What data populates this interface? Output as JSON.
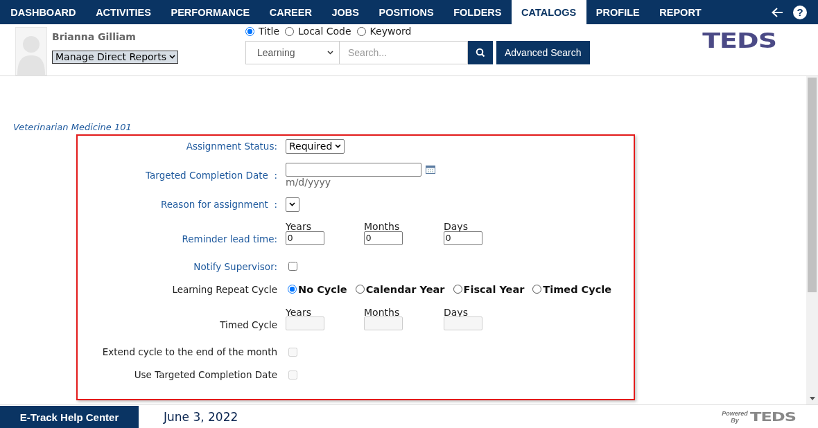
{
  "nav": {
    "items": [
      {
        "label": "DASHBOARD",
        "selected": false
      },
      {
        "label": "ACTIVITIES",
        "selected": false
      },
      {
        "label": "PERFORMANCE",
        "selected": false
      },
      {
        "label": "CAREER",
        "selected": false
      },
      {
        "label": "JOBS",
        "selected": false
      },
      {
        "label": "POSITIONS",
        "selected": false
      },
      {
        "label": "FOLDERS",
        "selected": false
      },
      {
        "label": "CATALOGS",
        "selected": true
      },
      {
        "label": "PROFILE",
        "selected": false
      },
      {
        "label": "REPORT",
        "selected": false
      }
    ],
    "help": "?"
  },
  "header": {
    "user_name": "Brianna Gilliam",
    "manage_select": "Manage Direct Reports",
    "search_by": [
      {
        "label": "Title",
        "selected": true
      },
      {
        "label": "Local Code",
        "selected": false
      },
      {
        "label": "Keyword",
        "selected": false
      }
    ],
    "category": "Learning",
    "search": {
      "placeholder": "Search..."
    },
    "advanced_search": "Advanced Search",
    "logo": "TEDS"
  },
  "content": {
    "course_title": "Veterinarian Medicine 101",
    "rows": [
      {
        "kind": "select",
        "label": "Assignment Status:",
        "color": "#1f5a9e",
        "value": "Required"
      },
      {
        "kind": "date",
        "label": "Targeted Completion Date  :",
        "color": "#1f5a9e",
        "hint": "m/d/yyyy"
      },
      {
        "kind": "select",
        "label": "Reason for assignment  :",
        "color": "#1f5a9e"
      },
      {
        "kind": "triple",
        "label": "Reminder lead time:",
        "color": "#1f5a9e",
        "fields": [
          {
            "label": "Years",
            "value": "0",
            "disabled": false
          },
          {
            "label": "Months",
            "value": "0",
            "disabled": false
          },
          {
            "label": "Days",
            "value": "0",
            "disabled": false
          }
        ]
      },
      {
        "kind": "checkbox",
        "label": "Notify Supervisor:",
        "color": "#1f5a9e",
        "checked": false,
        "disabled": false
      },
      {
        "kind": "radio",
        "label": "Learning Repeat Cycle",
        "color": "#222222",
        "options": [
          {
            "label": "No Cycle",
            "selected": true
          },
          {
            "label": "Calendar Year",
            "selected": false
          },
          {
            "label": "Fiscal Year",
            "selected": false
          },
          {
            "label": "Timed Cycle",
            "selected": false
          }
        ]
      },
      {
        "kind": "triple",
        "label": "Timed Cycle",
        "color": "#222222",
        "fields": [
          {
            "label": "Years",
            "disabled": true
          },
          {
            "label": "Months",
            "disabled": true
          },
          {
            "label": "Days",
            "disabled": true
          }
        ]
      },
      {
        "kind": "checkbox",
        "label": "Extend cycle to the end of the month",
        "color": "#222222",
        "checked": false,
        "disabled": true
      },
      {
        "kind": "checkbox",
        "label": "Use Targeted Completion Date",
        "color": "#222222",
        "checked": false,
        "disabled": true
      }
    ]
  },
  "footer": {
    "help_center": "E-Track Help Center",
    "date": "June 3, 2022",
    "powered_by": "Powered By",
    "logo": "TEDS"
  }
}
